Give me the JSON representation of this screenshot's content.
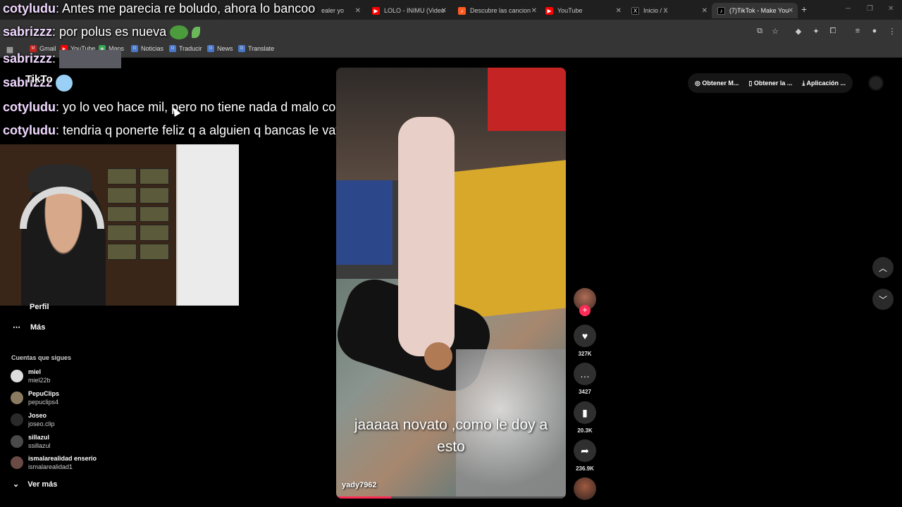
{
  "browser": {
    "tabs": [
      {
        "label": "ealer yo",
        "icon": "youtube-icon",
        "color": "#ff0000"
      },
      {
        "label": "LOLO - INIMU (Video",
        "icon": "youtube-icon",
        "color": "#ff0000"
      },
      {
        "label": "Descubre las cancion",
        "icon": "music-icon",
        "color": "#ff5a1f"
      },
      {
        "label": "YouTube",
        "icon": "youtube-icon",
        "color": "#ff0000"
      },
      {
        "label": "Inicio / X",
        "icon": "x-icon",
        "color": "#000000"
      },
      {
        "label": "(7)TikTok - Make You",
        "icon": "tiktok-icon",
        "color": "#000000",
        "active": true
      }
    ],
    "new_tab": "+",
    "bookmarks": [
      {
        "label": "Gmail"
      },
      {
        "label": "YouTube"
      },
      {
        "label": "Maps"
      },
      {
        "label": "Noticias"
      },
      {
        "label": "Traducir"
      },
      {
        "label": "News"
      },
      {
        "label": "Translate"
      }
    ]
  },
  "chat": [
    {
      "user": "cotyludu",
      "text": ": Antes me parecia re boludo, ahora lo bancoo"
    },
    {
      "user": "sabrizzz",
      "text": ": por polus es nueva"
    },
    {
      "user": "sabrizzz",
      "text": ":"
    },
    {
      "user": "sabrizzz",
      "text": ""
    },
    {
      "user": "cotyludu",
      "text": ": yo lo veo hace mil, pero no tiene nada d malo conocerlo hace poco"
    },
    {
      "user": "cotyludu",
      "text": ": tendria q ponerte feliz q a alguien q bancas le vaya bien"
    }
  ],
  "overlay_fragment": "TikTo",
  "sidebar": {
    "partial_item": "Perfil",
    "more_label": "Más",
    "following_title": "Cuentas que sigues",
    "following": [
      {
        "name": "miel",
        "handle": "miel22b"
      },
      {
        "name": "PepuClips",
        "handle": "pepuclips4"
      },
      {
        "name": "Joseo",
        "handle": "joseo.clip"
      },
      {
        "name": "sillazul",
        "handle": "ssillazul"
      },
      {
        "name": "ismalarealidad enserio",
        "handle": "ismalarealidad1"
      }
    ],
    "see_more": "Ver más"
  },
  "video": {
    "caption_line1": "jaaaaa novato ,como le doy a",
    "caption_line2": "esto",
    "username": "yady7962",
    "progress": 0.24
  },
  "actions": {
    "likes": "327K",
    "comments": "3427",
    "saves": "20.3K",
    "shares": "236.9K"
  },
  "top_actions": {
    "get_coins": "Obtener M...",
    "get_app": "Obtener la ...",
    "desktop_app": "Aplicación ..."
  },
  "colors": {
    "accent": "#fe2c55",
    "background": "#000000"
  }
}
